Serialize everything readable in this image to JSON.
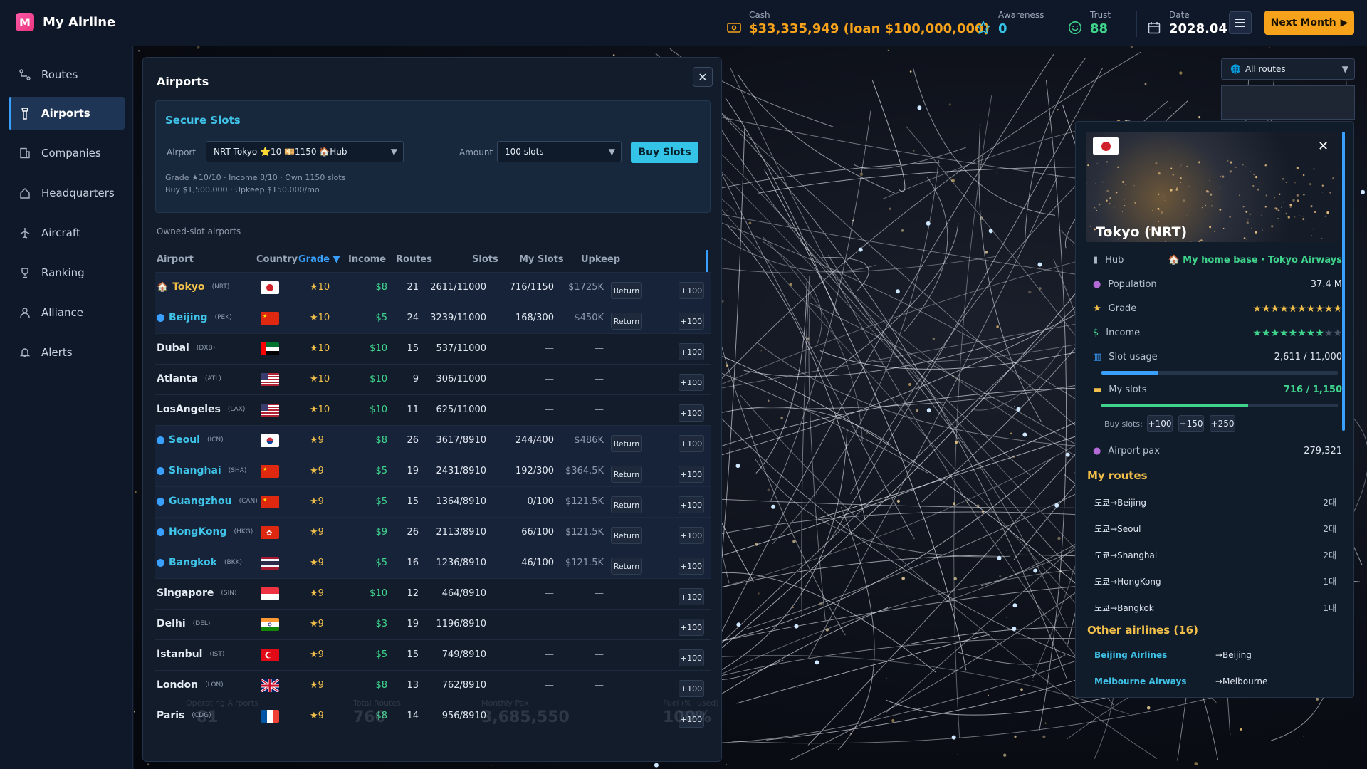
{
  "app": {
    "title": "My Airline",
    "logo_letter": "M"
  },
  "topbar": {
    "cash": {
      "label": "Cash",
      "value": "$33,335,949 (loan $100,000,000)",
      "color": "#f6a21a"
    },
    "awareness": {
      "label": "Awareness",
      "value": "0",
      "color": "#34c4e8"
    },
    "trust": {
      "label": "Trust",
      "value": "88",
      "color": "#3fd38c"
    },
    "date": {
      "label": "Date",
      "value": "2028.04"
    },
    "next_label": "Next Month"
  },
  "sidebar": {
    "items": [
      {
        "label": "Routes",
        "icon": "route-icon"
      },
      {
        "label": "Airports",
        "icon": "tower-icon",
        "active": true
      },
      {
        "label": "Companies",
        "icon": "building-icon"
      },
      {
        "label": "Headquarters",
        "icon": "home-icon"
      },
      {
        "label": "Aircraft",
        "icon": "plane-icon"
      },
      {
        "label": "Ranking",
        "icon": "trophy-icon"
      },
      {
        "label": "Alliance",
        "icon": "user-icon"
      },
      {
        "label": "Alerts",
        "icon": "bell-icon"
      }
    ]
  },
  "panel": {
    "title": "Airports",
    "secure": {
      "title": "Secure Slots",
      "airport_label": "Airport",
      "airport_value": "NRT Tokyo ⭐10 💴1150 🏠Hub",
      "amount_label": "Amount",
      "amount_value": "100 slots",
      "buy_label": "Buy Slots",
      "note1": "Grade ★10/10 · Income 8/10 · Own 1150 slots",
      "note2": "Buy $1,500,000 · Upkeep $150,000/mo"
    },
    "owned_label": "Owned-slot airports",
    "columns": {
      "airport": "Airport",
      "country": "Country",
      "grade": "Grade ▼",
      "income": "Income",
      "routes": "Routes",
      "slots": "Slots",
      "myslots": "My Slots",
      "upkeep": "Upkeep"
    },
    "rows": [
      {
        "name": "Tokyo",
        "code": "(NRT)",
        "flag": "jp",
        "grade": "★10",
        "income": "$8",
        "routes": "21",
        "slots": "2611/11000",
        "my": "716/1150",
        "upkeep": "$1725K",
        "owned": true,
        "hub": true
      },
      {
        "name": "Beijing",
        "code": "(PEK)",
        "flag": "cn",
        "grade": "★10",
        "income": "$5",
        "routes": "24",
        "slots": "3239/11000",
        "my": "168/300",
        "upkeep": "$450K",
        "owned": true
      },
      {
        "name": "Dubai",
        "code": "(DXB)",
        "flag": "ae",
        "grade": "★10",
        "income": "$10",
        "routes": "15",
        "slots": "537/11000",
        "my": "—",
        "upkeep": "—"
      },
      {
        "name": "Atlanta",
        "code": "(ATL)",
        "flag": "us",
        "grade": "★10",
        "income": "$10",
        "routes": "9",
        "slots": "306/11000",
        "my": "—",
        "upkeep": "—"
      },
      {
        "name": "LosAngeles",
        "code": "(LAX)",
        "flag": "us",
        "grade": "★10",
        "income": "$10",
        "routes": "11",
        "slots": "625/11000",
        "my": "—",
        "upkeep": "—"
      },
      {
        "name": "Seoul",
        "code": "(ICN)",
        "flag": "kr",
        "grade": "★9",
        "income": "$8",
        "routes": "26",
        "slots": "3617/8910",
        "my": "244/400",
        "upkeep": "$486K",
        "owned": true
      },
      {
        "name": "Shanghai",
        "code": "(SHA)",
        "flag": "cn",
        "grade": "★9",
        "income": "$5",
        "routes": "19",
        "slots": "2431/8910",
        "my": "192/300",
        "upkeep": "$364.5K",
        "owned": true
      },
      {
        "name": "Guangzhou",
        "code": "(CAN)",
        "flag": "cn",
        "grade": "★9",
        "income": "$5",
        "routes": "15",
        "slots": "1364/8910",
        "my": "0/100",
        "upkeep": "$121.5K",
        "owned": true
      },
      {
        "name": "HongKong",
        "code": "(HKG)",
        "flag": "hk",
        "grade": "★9",
        "income": "$9",
        "routes": "26",
        "slots": "2113/8910",
        "my": "66/100",
        "upkeep": "$121.5K",
        "owned": true
      },
      {
        "name": "Bangkok",
        "code": "(BKK)",
        "flag": "th",
        "grade": "★9",
        "income": "$5",
        "routes": "16",
        "slots": "1236/8910",
        "my": "46/100",
        "upkeep": "$121.5K",
        "owned": true
      },
      {
        "name": "Singapore",
        "code": "(SIN)",
        "flag": "sg",
        "grade": "★9",
        "income": "$10",
        "routes": "12",
        "slots": "464/8910",
        "my": "—",
        "upkeep": "—"
      },
      {
        "name": "Delhi",
        "code": "(DEL)",
        "flag": "in",
        "grade": "★9",
        "income": "$3",
        "routes": "19",
        "slots": "1196/8910",
        "my": "—",
        "upkeep": "—"
      },
      {
        "name": "Istanbul",
        "code": "(IST)",
        "flag": "tr",
        "grade": "★9",
        "income": "$5",
        "routes": "15",
        "slots": "749/8910",
        "my": "—",
        "upkeep": "—"
      },
      {
        "name": "London",
        "code": "(LON)",
        "flag": "gb",
        "grade": "★9",
        "income": "$8",
        "routes": "13",
        "slots": "762/8910",
        "my": "—",
        "upkeep": "—"
      },
      {
        "name": "Paris",
        "code": "(CDG)",
        "flag": "fr",
        "grade": "★9",
        "income": "$8",
        "routes": "14",
        "slots": "956/8910",
        "my": "—",
        "upkeep": "—"
      }
    ],
    "return_label": "Return",
    "plus_label": "+100",
    "background_stats": {
      "a_label": "Operating Airports",
      "a": "81",
      "b_label": "Total Routes",
      "b": "760",
      "c_label": "Monthly Pax",
      "c": "3,685,550",
      "d_label": "Fuel (%, used)",
      "d": "100%"
    }
  },
  "map": {
    "filter_label": "All routes"
  },
  "airport_detail": {
    "title": "Tokyo (NRT)",
    "hub_label": "Hub",
    "hub_value": "🏠 My home base · Tokyo Airways",
    "population_label": "Population",
    "population_value": "37.4 M",
    "grade_label": "Grade",
    "grade_stars": 10,
    "income_label": "Income",
    "income_stars": 8,
    "slot_usage_label": "Slot usage",
    "slot_usage_value": "2,611 / 11,000",
    "slot_usage_fraction": 0.237,
    "my_slots_label": "My slots",
    "my_slots_value": "716 / 1,150",
    "my_slots_fraction": 0.62,
    "buy_slots_label": "Buy slots:",
    "buy_options": [
      "+100",
      "+150",
      "+250"
    ],
    "airport_pax_label": "Airport pax",
    "airport_pax_value": "279,321",
    "my_routes_title": "My routes",
    "my_routes": [
      {
        "route": "도쿄→Beijing",
        "count": "2대"
      },
      {
        "route": "도쿄→Seoul",
        "count": "2대"
      },
      {
        "route": "도쿄→Shanghai",
        "count": "2대"
      },
      {
        "route": "도쿄→HongKong",
        "count": "1대"
      },
      {
        "route": "도쿄→Bangkok",
        "count": "1대"
      }
    ],
    "other_title": "Other airlines (16)",
    "other": [
      {
        "airline": "Beijing Airlines",
        "dest": "→Beijing"
      },
      {
        "airline": "Melbourne Airways",
        "dest": "→Melbourne"
      }
    ]
  }
}
